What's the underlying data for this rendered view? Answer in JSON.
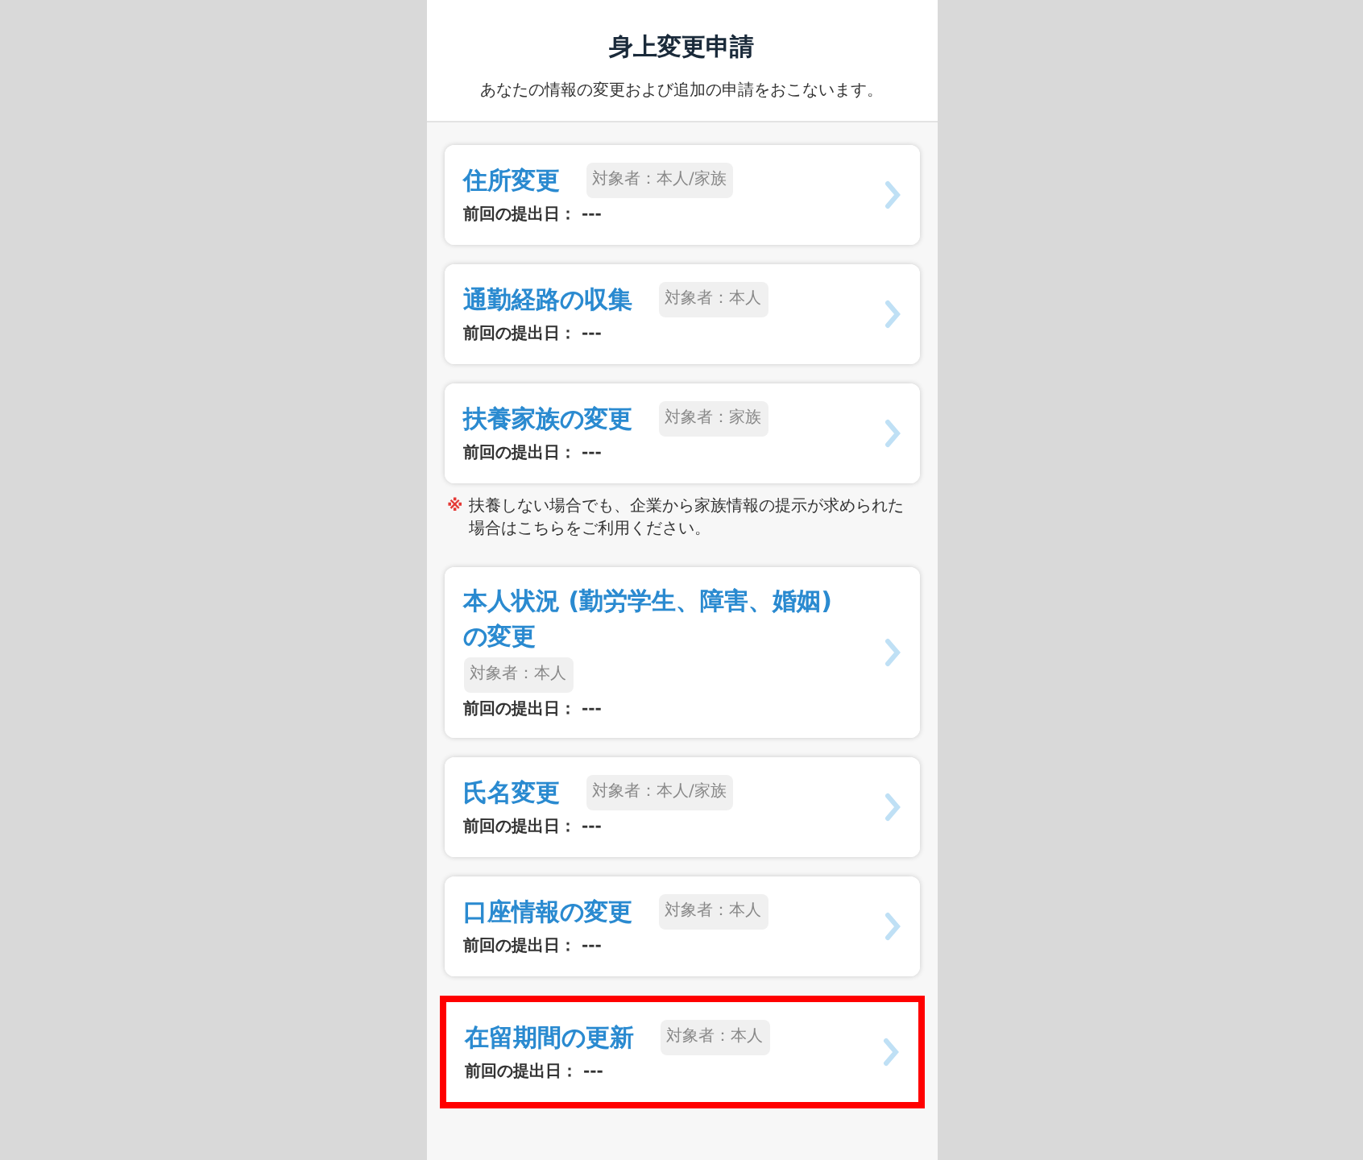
{
  "header": {
    "title": "身上変更申請",
    "subtitle": "あなたの情報の変更および追加の申請をおこないます。"
  },
  "items": [
    {
      "kind": "card",
      "title": "住所変更",
      "tag": "対象者：本人/家族",
      "submitted": "前回の提出日： ---",
      "highlighted": false
    },
    {
      "kind": "card",
      "title": "通勤経路の収集",
      "tag": "対象者：本人",
      "submitted": "前回の提出日： ---",
      "highlighted": false
    },
    {
      "kind": "card",
      "title": "扶養家族の変更",
      "tag": "対象者：家族",
      "submitted": "前回の提出日： ---",
      "highlighted": false
    },
    {
      "kind": "note",
      "mark": "※",
      "text": "扶養しない場合でも、企業から家族情報の提示が求められた場合はこちらをご利用ください。"
    },
    {
      "kind": "card",
      "title": "本人状況 (勤労学生、障害、婚姻) の変更",
      "tag": "対象者：本人",
      "submitted": "前回の提出日： ---",
      "highlighted": false
    },
    {
      "kind": "card",
      "title": "氏名変更",
      "tag": "対象者：本人/家族",
      "submitted": "前回の提出日： ---",
      "highlighted": false
    },
    {
      "kind": "card",
      "title": "口座情報の変更",
      "tag": "対象者：本人",
      "submitted": "前回の提出日： ---",
      "highlighted": false
    },
    {
      "kind": "card",
      "title": "在留期間の更新",
      "tag": "対象者：本人",
      "submitted": "前回の提出日： ---",
      "highlighted": true
    }
  ]
}
